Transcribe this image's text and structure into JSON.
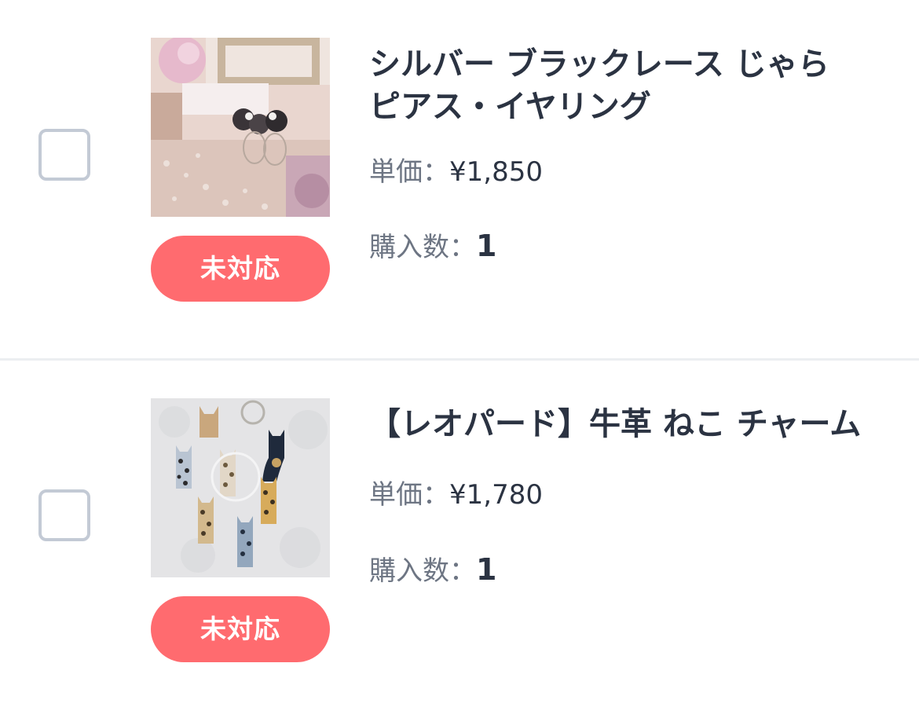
{
  "colors": {
    "status_badge_bg": "#ff6b6f",
    "status_badge_text": "#ffffff",
    "title_text": "#2b3342",
    "label_text": "#6d7583",
    "checkbox_border": "#c3cad5",
    "divider": "#eceef1"
  },
  "orders": [
    {
      "title": "シルバー ブラックレース じゃら\nピアス・イヤリング",
      "price_label": "単価：",
      "price_value": "¥1,850",
      "quantity_label": "購入数：",
      "quantity_value": "1",
      "status_label": "未対応",
      "checked": false,
      "thumbnail": "earrings-product-photo"
    },
    {
      "title": "【レオパード】牛革 ねこ チャーム",
      "price_label": "単価：",
      "price_value": "¥1,780",
      "quantity_label": "購入数：",
      "quantity_value": "1",
      "status_label": "未対応",
      "checked": false,
      "thumbnail": "cat-charm-product-photo"
    }
  ]
}
